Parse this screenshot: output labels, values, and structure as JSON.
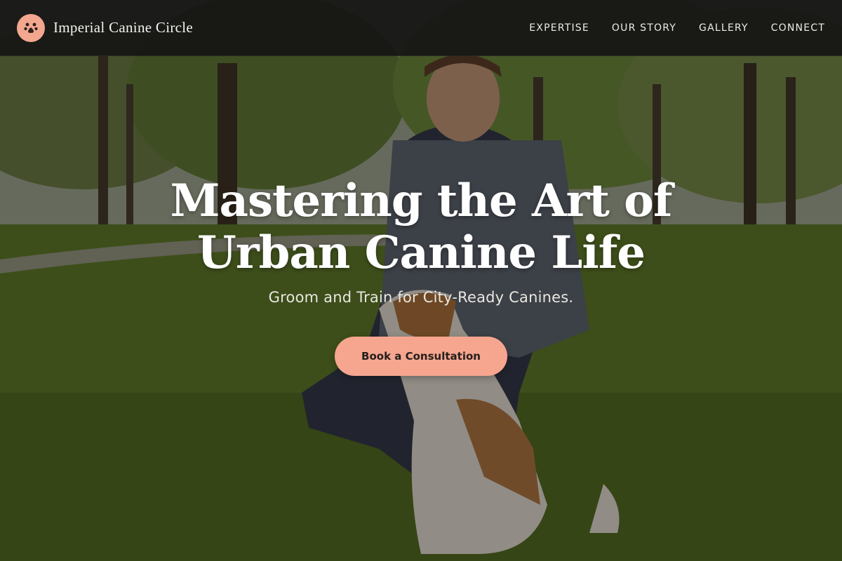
{
  "header": {
    "brand_name": "Imperial Canine Circle",
    "logo_icon": "paw-icon",
    "nav": [
      {
        "label": "EXPERTISE"
      },
      {
        "label": "OUR STORY"
      },
      {
        "label": "GALLERY"
      },
      {
        "label": "CONNECT"
      }
    ]
  },
  "hero": {
    "title_line1": "Mastering the Art of",
    "title_line2": "Urban Canine Life",
    "subtitle": "Groom and Train for City-Ready Canines.",
    "cta_label": "Book a Consultation"
  },
  "colors": {
    "accent": "#f6a58f",
    "header_bg": "#161514",
    "text_light": "#ffffff"
  }
}
